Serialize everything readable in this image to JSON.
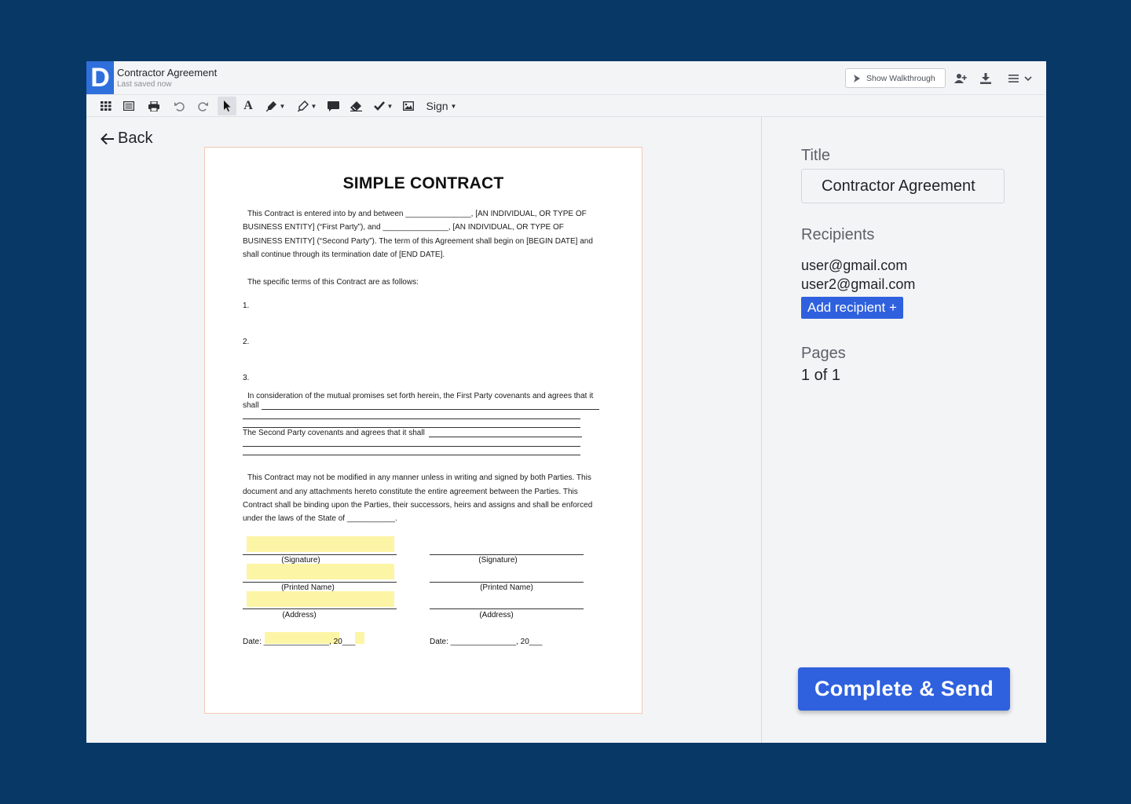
{
  "app": {
    "logo_letter": "D",
    "document_title": "Contractor Agreement",
    "save_status": "Last saved now",
    "walkthrough_label": "Show Walkthrough"
  },
  "toolbar": {
    "sign_label": "Sign",
    "icons": [
      "grid-icon",
      "list-icon",
      "print-icon",
      "undo-icon",
      "redo-icon",
      "cursor-icon",
      "text-icon",
      "pen-icon",
      "highlighter-icon",
      "comment-icon",
      "eraser-icon",
      "checkmark-icon",
      "image-icon"
    ]
  },
  "nav": {
    "back_label": "Back"
  },
  "contract": {
    "title": "SIMPLE CONTRACT",
    "intro_1": "This Contract is entered into by and between _______________, [AN INDIVIDUAL, OR TYPE OF",
    "intro_2": "BUSINESS ENTITY] (“First Party”), and _______________, [AN INDIVIDUAL, OR TYPE OF",
    "intro_3": "BUSINESS ENTITY] (“Second Party”).   The term of this Agreement shall begin on [BEGIN DATE] and",
    "intro_4": "shall continue through its termination date of [END DATE].",
    "terms_intro": "The specific terms of this Contract are as follows:",
    "item_1": "1.",
    "item_2": "2.",
    "item_3": "3.",
    "consideration_1": "In consideration of the mutual promises set forth herein, the First Party covenants and agrees that it",
    "consideration_2": "shall",
    "second_party": "The Second Party covenants and agrees that it shall",
    "modify_1": "This Contract may not be modified in any manner unless in writing and signed by both Parties. This",
    "modify_2": "document and any attachments hereto constitute the entire agreement between the Parties.  This",
    "modify_3": "Contract shall be binding upon the Parties, their successors, heirs and assigns and shall be enforced",
    "modify_4": "under the laws of the State of ___________.",
    "signature_label": "(Signature)",
    "printed_name_label": "(Printed Name)",
    "address_label": "(Address)",
    "date_left": "Date: _______________, 20___",
    "date_right": "Date: _______________, 20___"
  },
  "panel": {
    "title_label": "Title",
    "title_value": "Contractor Agreement",
    "recipients_label": "Recipients",
    "recipients": [
      "user@gmail.com",
      "user2@gmail.com"
    ],
    "add_recipient_label": "Add recipient +",
    "pages_label": "Pages",
    "pages_value": "1 of 1",
    "send_label": "Complete & Send"
  }
}
